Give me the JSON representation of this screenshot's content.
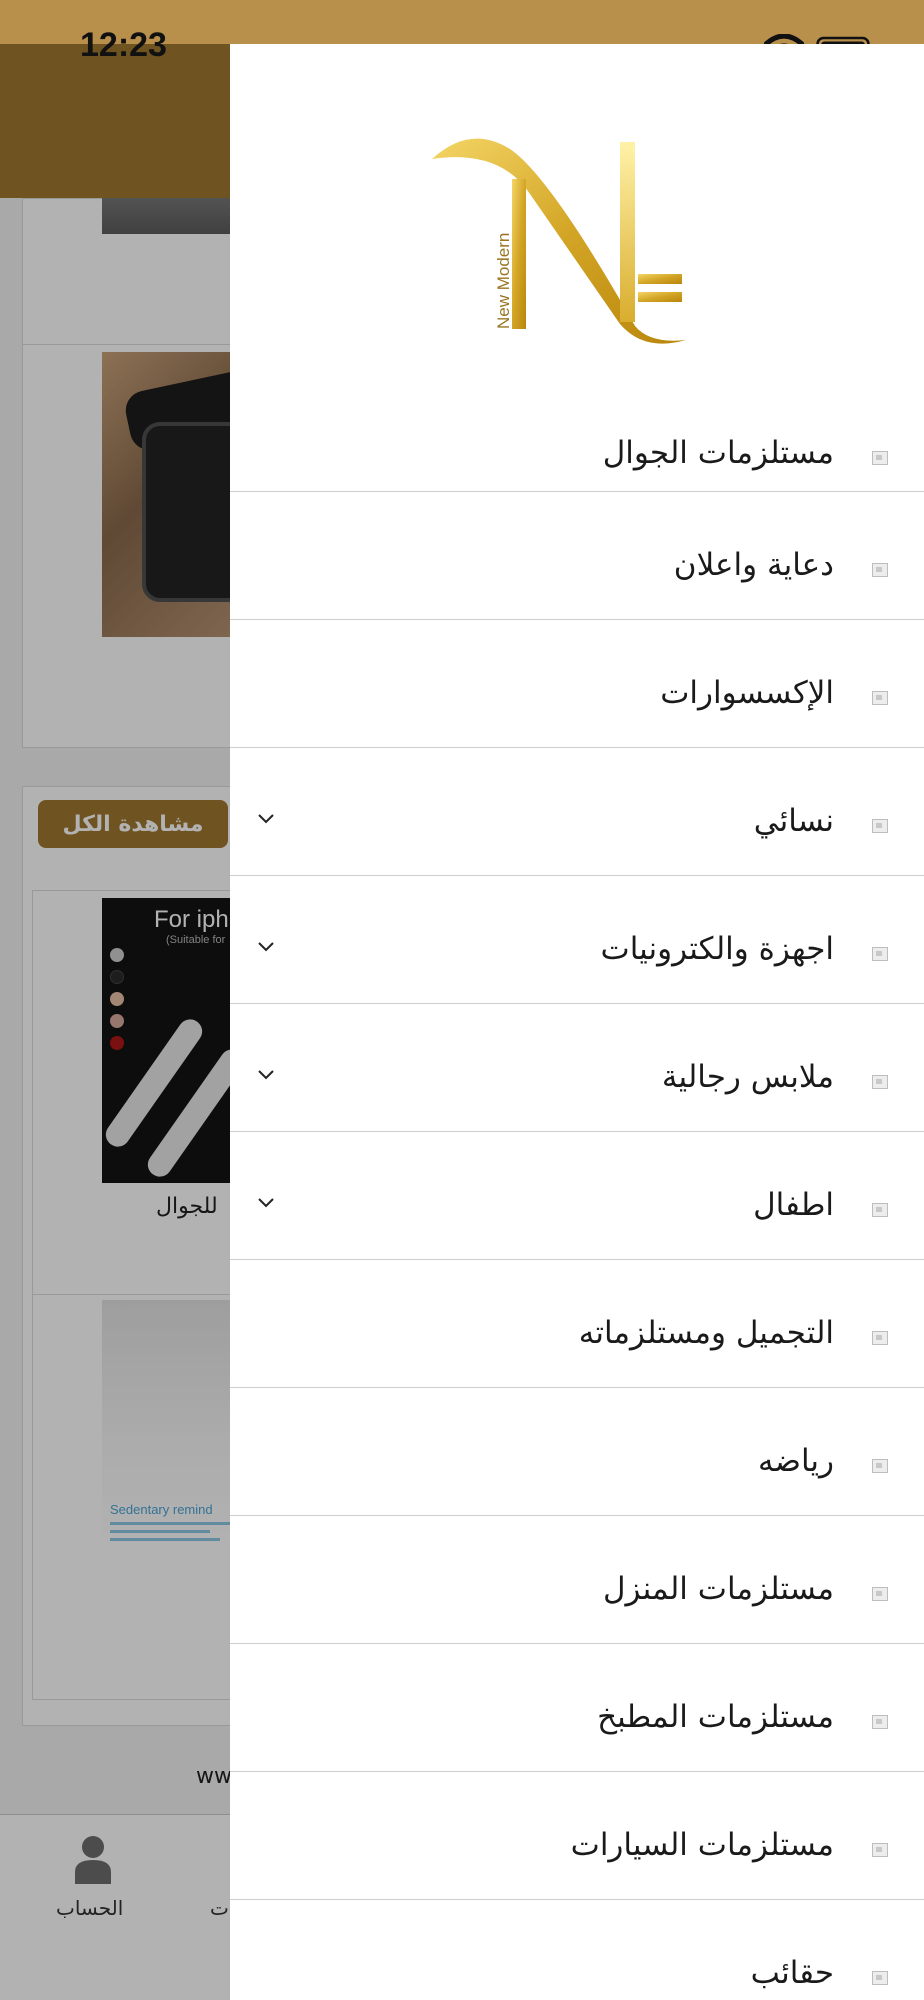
{
  "status_bar": {
    "time": "12:23"
  },
  "background": {
    "view_all_label": "مشاهدة الكل",
    "product_caption": "للجوال",
    "cable_image_text": "For iph",
    "cable_image_subtext": "(Suitable for",
    "reminder_image_text": "Sedentary remind",
    "footer_text": "ww",
    "tabbar": {
      "account_label": "الحساب",
      "partial_tab_label": "ت"
    }
  },
  "drawer": {
    "logo_text": "New Modern",
    "menu": [
      {
        "label": "مستلزمات الجوال",
        "icon": "image-placeholder-icon",
        "expandable": false
      },
      {
        "label": "دعاية واعلان",
        "icon": "image-placeholder-icon",
        "expandable": false
      },
      {
        "label": "الإكسسوارات",
        "icon": "image-placeholder-icon",
        "expandable": false
      },
      {
        "label": "نسائي",
        "icon": "image-placeholder-icon",
        "expandable": true
      },
      {
        "label": "اجهزة والكترونيات",
        "icon": "image-placeholder-icon",
        "expandable": true
      },
      {
        "label": "ملابس رجالية",
        "icon": "image-placeholder-icon",
        "expandable": true
      },
      {
        "label": "اطفال",
        "icon": "image-placeholder-icon",
        "expandable": true
      },
      {
        "label": "التجميل ومستلزماته",
        "icon": "image-placeholder-icon",
        "expandable": false
      },
      {
        "label": "رياضه",
        "icon": "image-placeholder-icon",
        "expandable": false
      },
      {
        "label": "مستلزمات المنزل",
        "icon": "image-placeholder-icon",
        "expandable": false
      },
      {
        "label": "مستلزمات المطبخ",
        "icon": "image-placeholder-icon",
        "expandable": false
      },
      {
        "label": "مستلزمات السيارات",
        "icon": "image-placeholder-icon",
        "expandable": false
      },
      {
        "label": "حقائب",
        "icon": "image-placeholder-icon",
        "expandable": false
      }
    ]
  },
  "colors": {
    "brand_gold": "#a07830",
    "status_bar_gold": "#b8904c",
    "logo_gold": "#d9ad2e"
  }
}
